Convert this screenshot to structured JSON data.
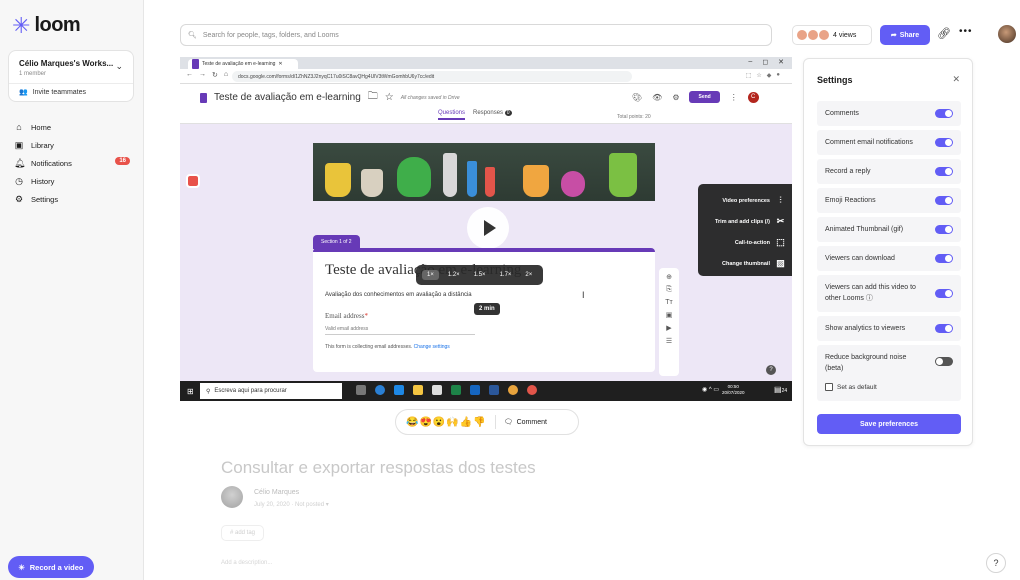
{
  "app": {
    "logo_text": "loom",
    "logo_icon": "loom-star-icon",
    "brand_color": "#625df5"
  },
  "sidebar": {
    "workspace_name": "Célio Marques's Works...",
    "workspace_members": "1 member",
    "invite_label": "Invite teammates",
    "nav": [
      {
        "label": "Home",
        "icon": "home-icon"
      },
      {
        "label": "Library",
        "icon": "library-icon"
      },
      {
        "label": "Notifications",
        "icon": "bell-icon",
        "badge": "16"
      },
      {
        "label": "History",
        "icon": "clock-icon"
      },
      {
        "label": "Settings",
        "icon": "gear-icon"
      }
    ],
    "record_label": "Record a video"
  },
  "topbar": {
    "search_placeholder": "Search for people, tags, folders, and Looms",
    "views_label": "4 views",
    "share_label": "Share"
  },
  "video": {
    "browser_tab": "Teste de avaliação em e-learning",
    "url": "docs.google.com/forms/d/1ZhNZ3J2nyqC17u0iSC8avQHg4UlV3tWmGomhbU6y7cc/edit",
    "form_title": "Teste de avaliação em e-learning",
    "saved_text": "All changes saved in Drive",
    "send_label": "Send",
    "avatar_letter": "C",
    "tab_questions": "Questions",
    "tab_responses": "Responses",
    "responses_count": "0",
    "total_points": "Total points: 20",
    "section_label": "Section 1 of 2",
    "card_title": "Teste de avaliação em e-learning",
    "card_desc": "Avaliação dos conhecimentos em avaliação a distância",
    "email_label": "Email address",
    "email_required": "*",
    "valid_email": "Valid email address",
    "collecting_text": "This form is collecting email addresses.",
    "change_settings": "Change settings",
    "speeds": [
      "1×",
      "1.2×",
      "1.5×",
      "1.7×",
      "2×"
    ],
    "duration": "2 min",
    "menu": [
      {
        "label": "Video preferences",
        "icon": "sliders-icon"
      },
      {
        "label": "Trim and add clips (/)",
        "icon": "scissors-icon"
      },
      {
        "label": "Call-to-action",
        "icon": "cursor-click-icon"
      },
      {
        "label": "Change thumbnail",
        "icon": "image-icon"
      }
    ],
    "taskbar_search": "Escreva aqui para procurar",
    "clock_time": "00:50",
    "clock_date": "20/07/2020",
    "notif_count": "24"
  },
  "reactions": {
    "emojis": "😂😍😮🙌👍👎",
    "comment_label": "Comment"
  },
  "details": {
    "title": "Consultar e exportar respostas dos testes",
    "author": "Célio Marques",
    "date": "July 20, 2020",
    "visibility": "Not posted",
    "add_tag": "# add tag",
    "add_description": "Add a description..."
  },
  "settings": {
    "title": "Settings",
    "rows": [
      {
        "label": "Comments",
        "on": true
      },
      {
        "label": "Comment email notifications",
        "on": true
      },
      {
        "label": "Record a reply",
        "on": true
      },
      {
        "label": "Emoji Reactions",
        "on": true
      },
      {
        "label": "Animated Thumbnail (gif)",
        "on": true
      },
      {
        "label": "Viewers can download",
        "on": true
      },
      {
        "label": "Viewers can add this video to other Looms",
        "on": true
      },
      {
        "label": "Show analytics to viewers",
        "on": true
      },
      {
        "label": "Reduce background noise (beta)",
        "on": false
      }
    ],
    "set_default_label": "Set as default",
    "save_label": "Save preferences"
  }
}
